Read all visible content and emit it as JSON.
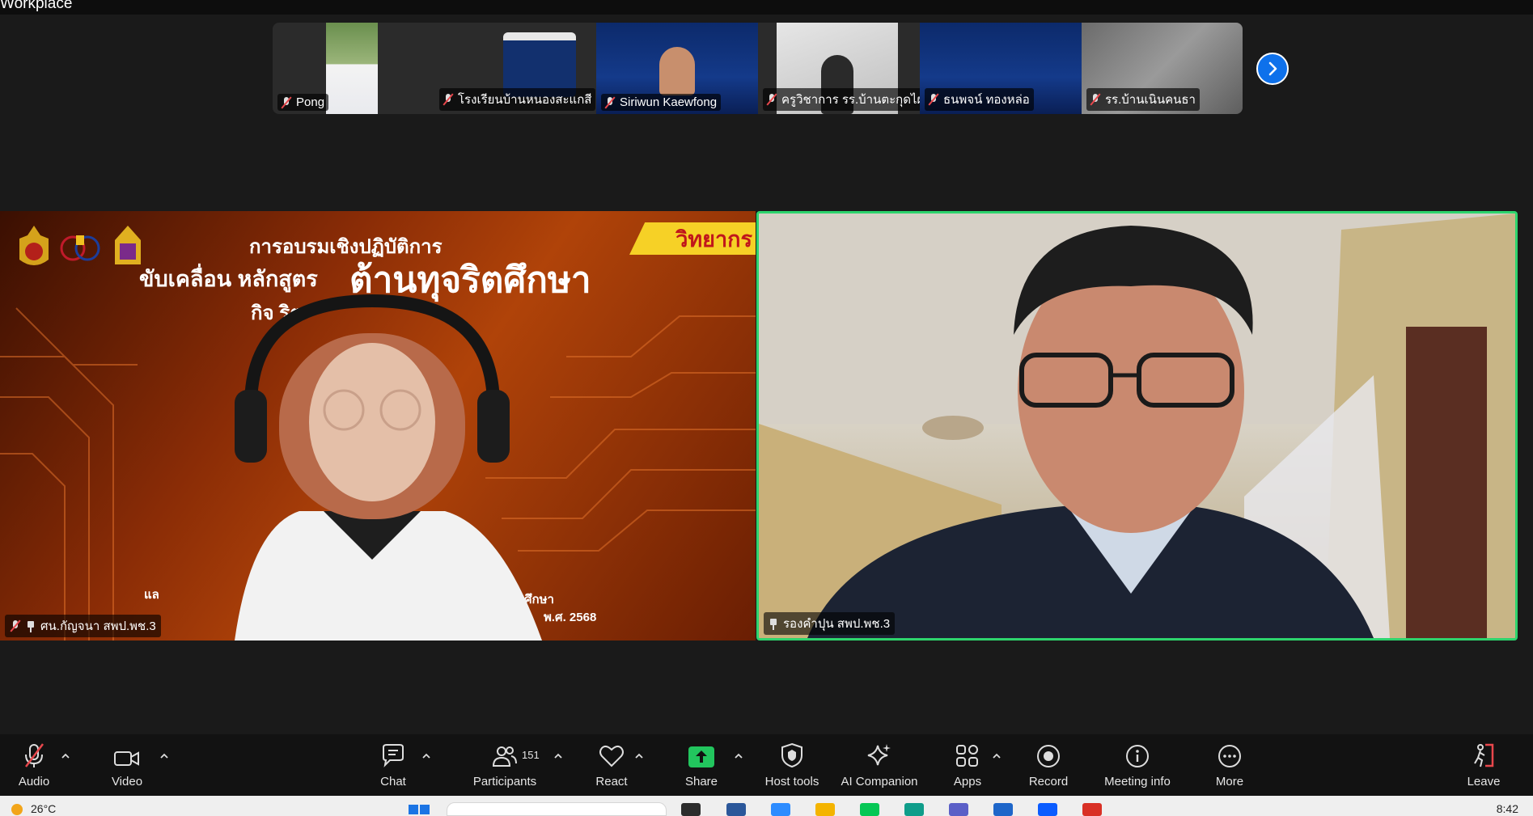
{
  "window": {
    "title": "Workplace"
  },
  "thumbnails": [
    {
      "name": "Pong",
      "muted": true
    },
    {
      "name": "โรงเรียนบ้านหนองสะแกสี",
      "muted": true
    },
    {
      "name": "Siriwun Kaewfong",
      "muted": true
    },
    {
      "name": "ครูวิชาการ รร.บ้านตะกุดไผ่",
      "muted": true
    },
    {
      "name": "ธนพจน์ ทองหล่อ",
      "muted": true
    },
    {
      "name": "รร.บ้านเนินคนธา",
      "muted": true
    }
  ],
  "main_tiles": {
    "left": {
      "name": "ศน.กัญจนา สพป.พช.3",
      "banner": {
        "line1": "การอบรมเชิงปฏิบัติการ",
        "line2a": "ขับเคลื่อน หลักสูตร",
        "line2b": "ต้านทุจริตศึกษา",
        "line3": "กิจ              ริต",
        "tag": "วิทยากร",
        "foot_left": "แล",
        "foot_right1": "ศึกษา",
        "foot_right2": "พ.ศ. 2568"
      }
    },
    "right": {
      "name": "รองคำปุน สพป.พช.3",
      "active_speaker": true
    }
  },
  "toolbar": {
    "audio": "Audio",
    "video": "Video",
    "chat": "Chat",
    "participants": "Participants",
    "participants_count": "151",
    "react": "React",
    "share": "Share",
    "host_tools": "Host tools",
    "ai_companion": "AI Companion",
    "apps": "Apps",
    "record": "Record",
    "meeting_info": "Meeting info",
    "more": "More",
    "leave": "Leave"
  },
  "taskbar": {
    "temperature": "26°C",
    "time": "8:42"
  },
  "colors": {
    "accent_blue": "#0e71eb",
    "active_speaker_border": "#2ed46d",
    "share_green": "#22c55e",
    "leave_red": "#e8474c"
  }
}
